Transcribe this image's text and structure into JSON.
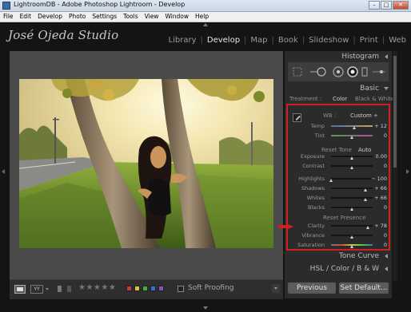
{
  "window": {
    "title": "LightroomDB - Adobe Photoshop Lightroom - Develop",
    "min_glyph": "–",
    "max_glyph": "□",
    "close_glyph": "✕"
  },
  "menu": [
    "File",
    "Edit",
    "Develop",
    "Photo",
    "Settings",
    "Tools",
    "View",
    "Window",
    "Help"
  ],
  "header": {
    "brand": "José Ojeda Studio",
    "modules": [
      {
        "label": "Library",
        "active": false
      },
      {
        "label": "Develop",
        "active": true
      },
      {
        "label": "Map",
        "active": false
      },
      {
        "label": "Book",
        "active": false
      },
      {
        "label": "Slideshow",
        "active": false
      },
      {
        "label": "Print",
        "active": false
      },
      {
        "label": "Web",
        "active": false
      }
    ]
  },
  "panel": {
    "histogram": "Histogram",
    "basic": "Basic",
    "treatment": {
      "label": "Treatment :",
      "color": "Color",
      "bw": "Black & White"
    },
    "wb": {
      "label": "WB :",
      "value": "Custom ÷"
    },
    "tone_header": "Reset Tone",
    "tone_auto": "Auto",
    "presence_header": "Reset Presence",
    "sliders": [
      {
        "label": "Temp",
        "value": "+ 12",
        "pos": 0.56,
        "track": "temp"
      },
      {
        "label": "Tint",
        "value": "0",
        "pos": 0.5,
        "track": "tint"
      },
      {
        "label": "Exposure",
        "value": "0.00",
        "pos": 0.5,
        "track": "gray"
      },
      {
        "label": "Contrast",
        "value": "0",
        "pos": 0.5,
        "track": "gray"
      },
      {
        "label": "Highlights",
        "value": "− 100",
        "pos": 0.0,
        "track": "gray"
      },
      {
        "label": "Shadows",
        "value": "+ 66",
        "pos": 0.83,
        "track": "gray"
      },
      {
        "label": "Whites",
        "value": "+ 66",
        "pos": 0.83,
        "track": "gray"
      },
      {
        "label": "Blacks",
        "value": "0",
        "pos": 0.5,
        "track": "gray"
      },
      {
        "label": "Clarity",
        "value": "+ 78",
        "pos": 0.89,
        "track": "gray"
      },
      {
        "label": "Vibrance",
        "value": "0",
        "pos": 0.5,
        "track": "gray"
      },
      {
        "label": "Saturation",
        "value": "0",
        "pos": 0.5,
        "track": "sat"
      }
    ],
    "tone_curve": "Tone Curve",
    "hsl_tabs": "HSL  /  Color  /  B & W",
    "previous": "Previous",
    "set_default": "Set Default..."
  },
  "toolbar": {
    "yy": "YY",
    "stars": "★★★★★",
    "soft_proofing": "Soft Proofing",
    "color_labels": [
      "#c43c3c",
      "#d8c23a",
      "#4fa44a",
      "#3a6fc4",
      "#8a4fb8"
    ]
  }
}
